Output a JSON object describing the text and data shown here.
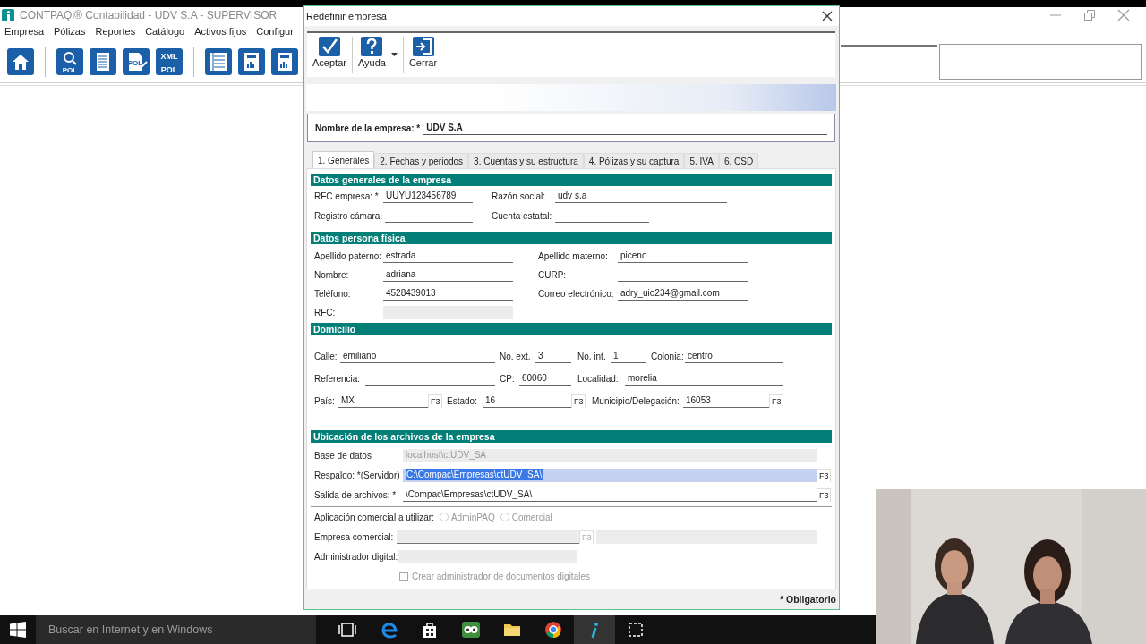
{
  "app": {
    "title": "CONTPAQi® Contabilidad - UDV S.A - SUPERVISOR",
    "menu": [
      "Empresa",
      "Pólizas",
      "Reportes",
      "Catálogo",
      "Activos fijos",
      "Configur"
    ],
    "toolbar": [
      {
        "kind": "home"
      },
      {
        "kind": "search",
        "texts": [
          "POL"
        ]
      },
      {
        "kind": "document"
      },
      {
        "kind": "edit",
        "texts": [
          "POL"
        ]
      },
      {
        "kind": "xml",
        "texts": [
          "XML",
          "POL"
        ]
      },
      {
        "kind": "list"
      },
      {
        "kind": "report"
      },
      {
        "kind": "report"
      }
    ]
  },
  "dialog": {
    "title": "Redefinir empresa",
    "toolbar": [
      {
        "kind": "accept",
        "label": "Aceptar"
      },
      {
        "kind": "help",
        "label": "Ayuda"
      },
      {
        "kind": "close",
        "label": "Cerrar"
      }
    ],
    "company_name": {
      "label": "Nombre de la empresa: *",
      "value": "UDV S.A"
    },
    "tabs": [
      {
        "label": "1. Generales",
        "selected": true
      },
      {
        "label": "2. Fechas y periodos",
        "selected": false
      },
      {
        "label": "3. Cuentas y su estructura",
        "selected": false
      },
      {
        "label": "4. Pólizas y su captura",
        "selected": false
      },
      {
        "label": "5. IVA",
        "selected": false
      },
      {
        "label": "6. CSD",
        "selected": false
      }
    ],
    "sections": [
      {
        "title": "Datos generales de la empresa",
        "rows": [
          [
            {
              "label": "RFC empresa: *",
              "value": "UUYU123456789",
              "kind": "text"
            },
            {
              "label": "Razón social:",
              "value": "udv s.a",
              "kind": "text"
            }
          ],
          [
            {
              "label": "Registro cámara:",
              "kind": "text"
            },
            {
              "label": "Cuenta estatal:",
              "kind": "text"
            }
          ]
        ]
      },
      {
        "title": "Datos persona física",
        "rows": [
          [
            {
              "label": "Apellido paterno:",
              "value": "estrada",
              "kind": "text"
            },
            {
              "label": "Apellido materno:",
              "value": "piceno",
              "kind": "text"
            }
          ],
          [
            {
              "label": "Nombre:",
              "value": "adriana",
              "kind": "text"
            },
            {
              "label": "CURP:",
              "kind": "text"
            }
          ],
          [
            {
              "label": "Teléfono:",
              "value": "4528439013",
              "kind": "text"
            },
            {
              "label": "Correo electrónico:",
              "value": "adry_uio234@gmail.com",
              "kind": "text"
            }
          ],
          [
            {
              "label": "RFC:",
              "kind": "disabled"
            }
          ]
        ]
      },
      {
        "title": "Domicilio",
        "rows": [
          [
            {
              "label": "Calle:",
              "value": "emiliano",
              "kind": "text"
            },
            {
              "label": "No. ext.",
              "value": "3",
              "kind": "text"
            },
            {
              "label": "No. int.",
              "value": "1",
              "kind": "text"
            },
            {
              "label": "Colonia:",
              "value": "centro",
              "kind": "text"
            }
          ],
          [
            {
              "label": "Referencia:",
              "kind": "text"
            },
            {
              "label": "CP:",
              "value": "60060",
              "kind": "text"
            },
            {
              "label": "Localidad:",
              "value": "morelia",
              "kind": "text"
            }
          ],
          [
            {
              "label": "País:",
              "value": "MX",
              "kind": "text",
              "key": "F3"
            },
            {
              "label": "Estado:",
              "value": "16",
              "kind": "text",
              "key": "F3"
            },
            {
              "label": "Municipio/Delegación:",
              "value": "16053",
              "kind": "text",
              "key": "F3"
            }
          ]
        ]
      },
      {
        "title": "Ubicación de los archivos de la empresa",
        "rows": [
          [
            {
              "label": "Base de datos",
              "value": "localhost\\ctUDV_SA",
              "kind": "disabled"
            }
          ],
          [
            {
              "label": "Respaldo: *(Servidor)",
              "value": "C:\\Compac\\Empresas\\ctUDV_SA\\",
              "kind": "highlighted",
              "key": "F3"
            }
          ],
          [
            {
              "label": "Salida de archivos: *",
              "value": "\\Compac\\Empresas\\ctUDV_SA\\",
              "kind": "text",
              "key": "F3"
            }
          ]
        ]
      }
    ],
    "application": {
      "label": "Aplicación comercial a utilizar:",
      "options": [
        {
          "label": "AdminPAQ",
          "selected": false,
          "disabled": true
        },
        {
          "label": "Comercial",
          "selected": false,
          "disabled": true
        }
      ]
    },
    "commercial_company": {
      "label": "Empresa comercial:",
      "key": "F3",
      "disabled": true
    },
    "digital_admin": {
      "label": "Administrador digital:",
      "disabled": true
    },
    "create_admin": {
      "label": "Crear administrador de documentos digitales",
      "checked": false,
      "disabled": true
    },
    "footer": "* Obligatorio"
  },
  "taskbar": {
    "search": "Buscar en Internet y en Windows",
    "apps": [
      {
        "kind": "taskview",
        "active": false
      },
      {
        "kind": "edge",
        "active": false
      },
      {
        "kind": "store",
        "active": false
      },
      {
        "kind": "owl",
        "active": false
      },
      {
        "kind": "folder",
        "active": false
      },
      {
        "kind": "chrome",
        "active": false
      },
      {
        "kind": "contpaqi",
        "active": true
      },
      {
        "kind": "snip",
        "active": false
      }
    ]
  }
}
